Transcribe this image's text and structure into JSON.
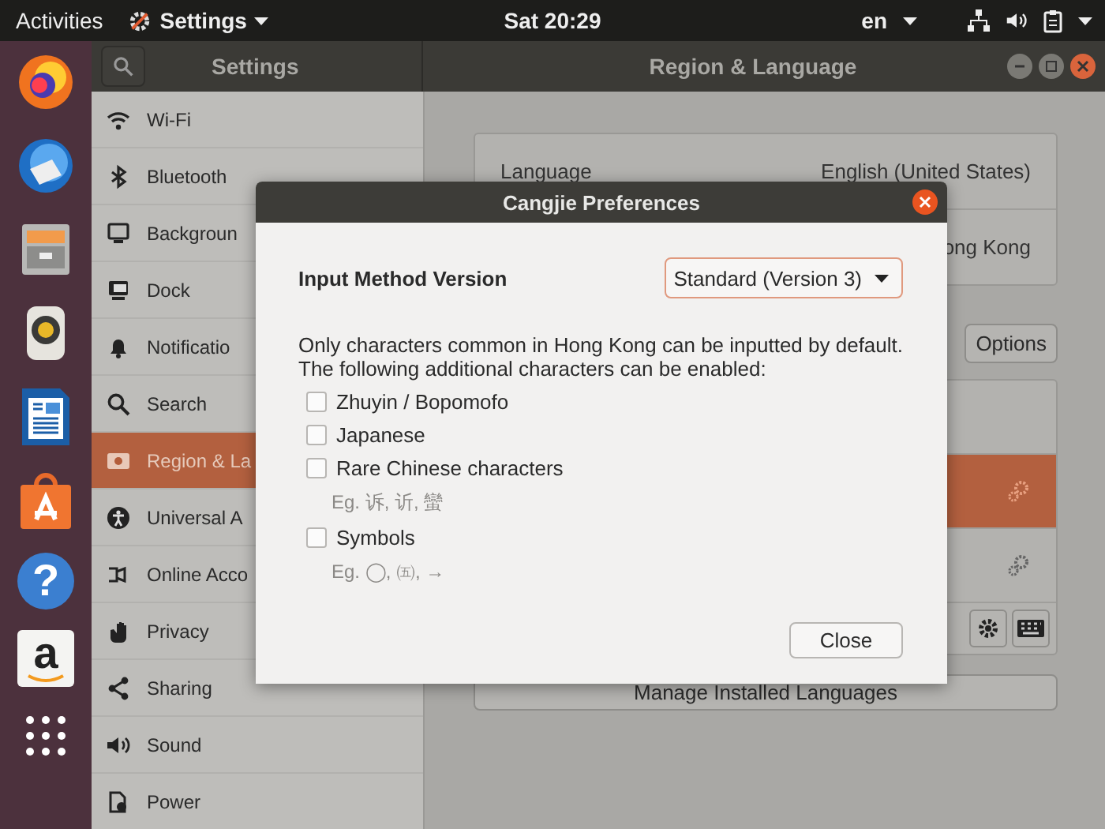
{
  "top_bar": {
    "activities": "Activities",
    "app_menu": "Settings",
    "clock": "Sat 20:29",
    "keyboard_layout": "en"
  },
  "dock": {
    "help_glyph": "?",
    "store_glyph": "a"
  },
  "window": {
    "sidebar_title": "Settings",
    "title": "Region & Language"
  },
  "sidebar": {
    "items": [
      {
        "label": "Wi-Fi",
        "selected": false
      },
      {
        "label": "Bluetooth",
        "selected": false
      },
      {
        "label": "Backgroun",
        "selected": false
      },
      {
        "label": "Dock",
        "selected": false
      },
      {
        "label": "Notificatio",
        "selected": false
      },
      {
        "label": "Search",
        "selected": false
      },
      {
        "label": "Region & La",
        "selected": true
      },
      {
        "label": "Universal A",
        "selected": false
      },
      {
        "label": "Online Acco",
        "selected": false
      },
      {
        "label": "Privacy",
        "selected": false
      },
      {
        "label": "Sharing",
        "selected": false
      },
      {
        "label": "Sound",
        "selected": false
      },
      {
        "label": "Power",
        "selected": false
      }
    ]
  },
  "region_panel": {
    "rows": [
      {
        "label": "Language",
        "value": "English (United States)"
      },
      {
        "value": "ong Kong"
      }
    ]
  },
  "input_sources": {
    "options_button": "Options",
    "rows": [
      {
        "selected": false,
        "has_settings": false
      },
      {
        "selected": true,
        "has_settings": true
      },
      {
        "selected": false,
        "has_settings": true
      }
    ]
  },
  "manage_button": "Manage Installed Languages",
  "dialog": {
    "title": "Cangjie Preferences",
    "version_label": "Input Method Version",
    "version_value": "Standard (Version 3)",
    "description_lines": [
      "Only characters common in Hong Kong can be inputted by default.",
      "The following additional characters can be enabled:"
    ],
    "options": [
      {
        "label": "Zhuyin / Bopomofo",
        "checked": false
      },
      {
        "label": "Japanese",
        "checked": false
      },
      {
        "label": "Rare Chinese characters",
        "checked": false,
        "example": "Eg. 诉, 䜣, 蠻"
      },
      {
        "label": "Symbols",
        "checked": false,
        "example": "Eg. ◯, ㈤, →"
      }
    ],
    "close_button": "Close"
  }
}
